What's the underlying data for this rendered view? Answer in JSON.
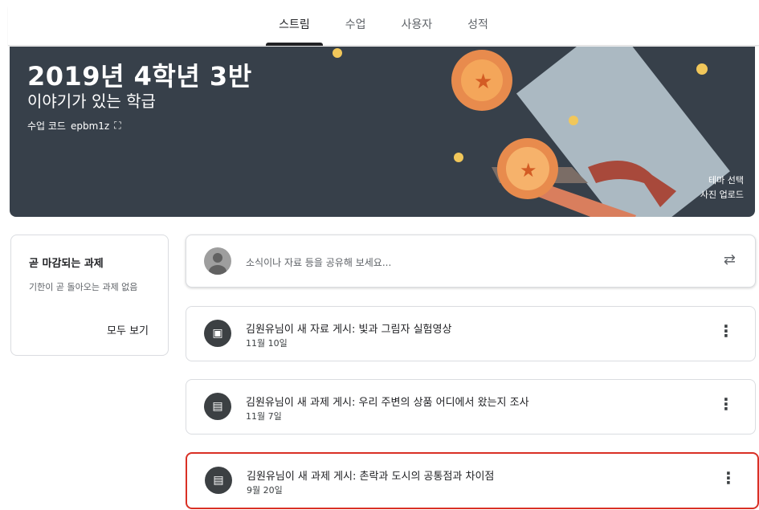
{
  "tabs": [
    "스트림",
    "수업",
    "사용자",
    "성적"
  ],
  "active_tab": "스트림",
  "banner": {
    "title": "2019년 4학년 3반",
    "subtitle": "이야기가 있는 학급",
    "code_label": "수업 코드",
    "code_value": "epbm1z",
    "select_theme": "테마 선택",
    "upload_photo": "사진 업로드"
  },
  "upcoming": {
    "title": "곧 마감되는 과제",
    "desc": "기한이 곧 돌아오는 과제 없음",
    "view_all": "모두 보기"
  },
  "share": {
    "placeholder": "소식이나 자료 등을 공유해 보세요..."
  },
  "posts": [
    {
      "title": "김원유님이 새 자료 게시: 빛과 그림자 실험영상",
      "date": "11월 10일",
      "icon": "material-icon"
    },
    {
      "title": "김원유님이 새 과제 게시: 우리 주변의 상품 어디에서 왔는지 조사",
      "date": "11월 7일",
      "icon": "assignment-icon"
    },
    {
      "title": "김원유님이 새 과제 게시: 촌락과 도시의 공통점과 차이점",
      "date": "9월 20일",
      "icon": "assignment-icon"
    }
  ],
  "colors": {
    "highlight": "#d93025",
    "banner": "#37404a"
  }
}
